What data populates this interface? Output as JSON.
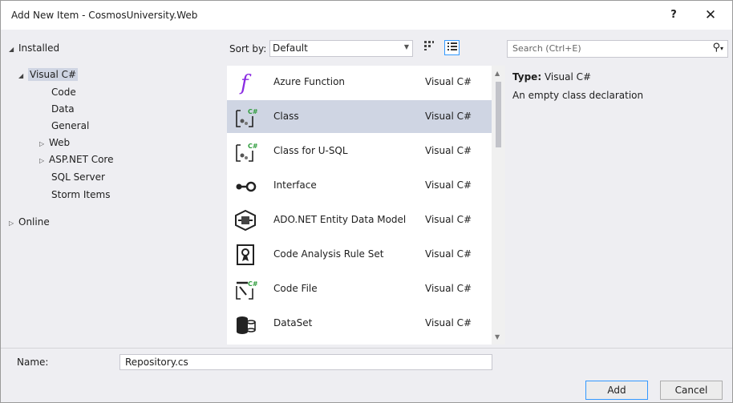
{
  "window": {
    "title": "Add New Item - CosmosUniversity.Web",
    "help_label": "?",
    "close_label": "✕"
  },
  "tree": {
    "installed": "Installed",
    "visual_csharp": "Visual C#",
    "children": [
      "Code",
      "Data",
      "General",
      "Web",
      "ASP.NET Core",
      "SQL Server",
      "Storm Items"
    ],
    "online": "Online"
  },
  "toolbar": {
    "sort_label": "Sort by:",
    "sort_value": "Default"
  },
  "search": {
    "placeholder": "Search (Ctrl+E)"
  },
  "items": [
    {
      "name": "Azure Function",
      "lang": "Visual C#",
      "icon": "azure-function-icon"
    },
    {
      "name": "Class",
      "lang": "Visual C#",
      "icon": "class-icon",
      "selected": true
    },
    {
      "name": "Class for U-SQL",
      "lang": "Visual C#",
      "icon": "class-usql-icon"
    },
    {
      "name": "Interface",
      "lang": "Visual C#",
      "icon": "interface-icon"
    },
    {
      "name": "ADO.NET Entity Data Model",
      "lang": "Visual C#",
      "icon": "entity-model-icon"
    },
    {
      "name": "Code Analysis Rule Set",
      "lang": "Visual C#",
      "icon": "rule-set-icon"
    },
    {
      "name": "Code File",
      "lang": "Visual C#",
      "icon": "code-file-icon"
    },
    {
      "name": "DataSet",
      "lang": "Visual C#",
      "icon": "dataset-icon"
    }
  ],
  "details": {
    "type_label": "Type:",
    "type_value": "Visual C#",
    "description": "An empty class declaration"
  },
  "name_field": {
    "label": "Name:",
    "value": "Repository.cs"
  },
  "buttons": {
    "add": "Add",
    "cancel": "Cancel"
  },
  "colors": {
    "selection": "#cfd5e3",
    "accent_purple": "#8a2be2",
    "dialog_bg": "#eeeef2"
  }
}
